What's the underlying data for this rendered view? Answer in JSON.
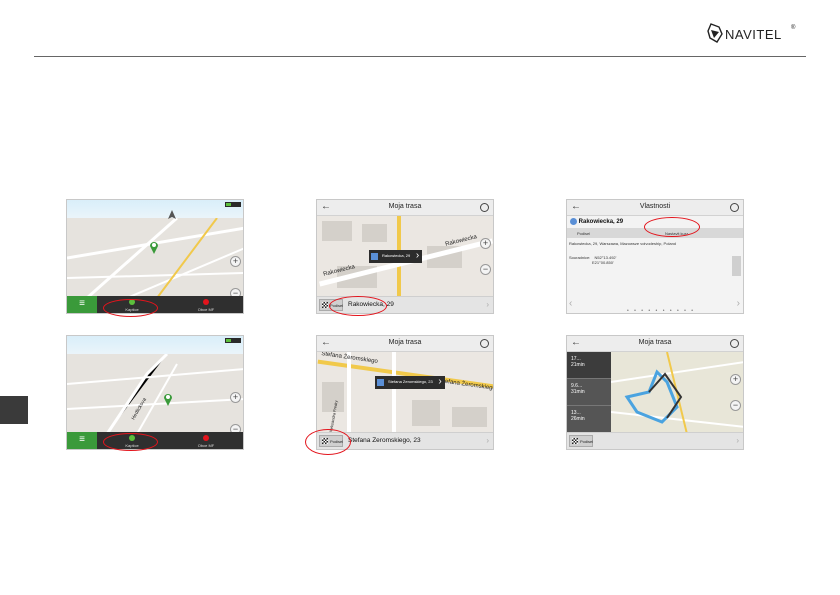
{
  "brand": {
    "name": "NAVITEL",
    "mark": "®"
  },
  "screens": {
    "s1": {
      "buttons": [
        "Kaptice",
        "Obce MF"
      ]
    },
    "s2": {
      "title": "Moja trasa",
      "popup": "Rakowiecka, 29",
      "streets": [
        "Rakowiecka",
        "Rakowiecka"
      ],
      "footer_btn": "Podisel",
      "address": "Rakowiecka, 29"
    },
    "s3": {
      "title": "Vlastnosti",
      "place": "Rakowiecka, 29",
      "btn_left": "Podisel",
      "btn_right": "Nastavit kurz",
      "address_line": "Rakowiecka, 29, Warszawa, Mazowsze voivodeship, Poland",
      "coords_label": "Souradnice:",
      "coords": [
        "N52°13.492'",
        "E21°00.850'"
      ]
    },
    "s4": {
      "buttons": [
        "Kaptice",
        "Obce MF"
      ],
      "streets": [
        "Hedlickova"
      ]
    },
    "s5": {
      "title": "Moja trasa",
      "popup": "Stefana Zeromskiego, 23",
      "streets": [
        "Stefana Żeromskiego",
        "Stefana Żeromskiego",
        "Aleksandra Fredry"
      ],
      "footer_btn": "Podisel",
      "address": "Stefana Zeromskiego, 23"
    },
    "s6": {
      "title": "Moja trasa",
      "routes": [
        {
          "dist": "17...",
          "time": "21min"
        },
        {
          "dist": "9.6...",
          "time": "31min"
        },
        {
          "dist": "13...",
          "time": "26min"
        }
      ],
      "footer_btn": "Podisel"
    }
  },
  "colors": {
    "highlight": "#e3141c",
    "nav_green": "#3a9a3a",
    "route_blue": "#4aa3e0"
  }
}
